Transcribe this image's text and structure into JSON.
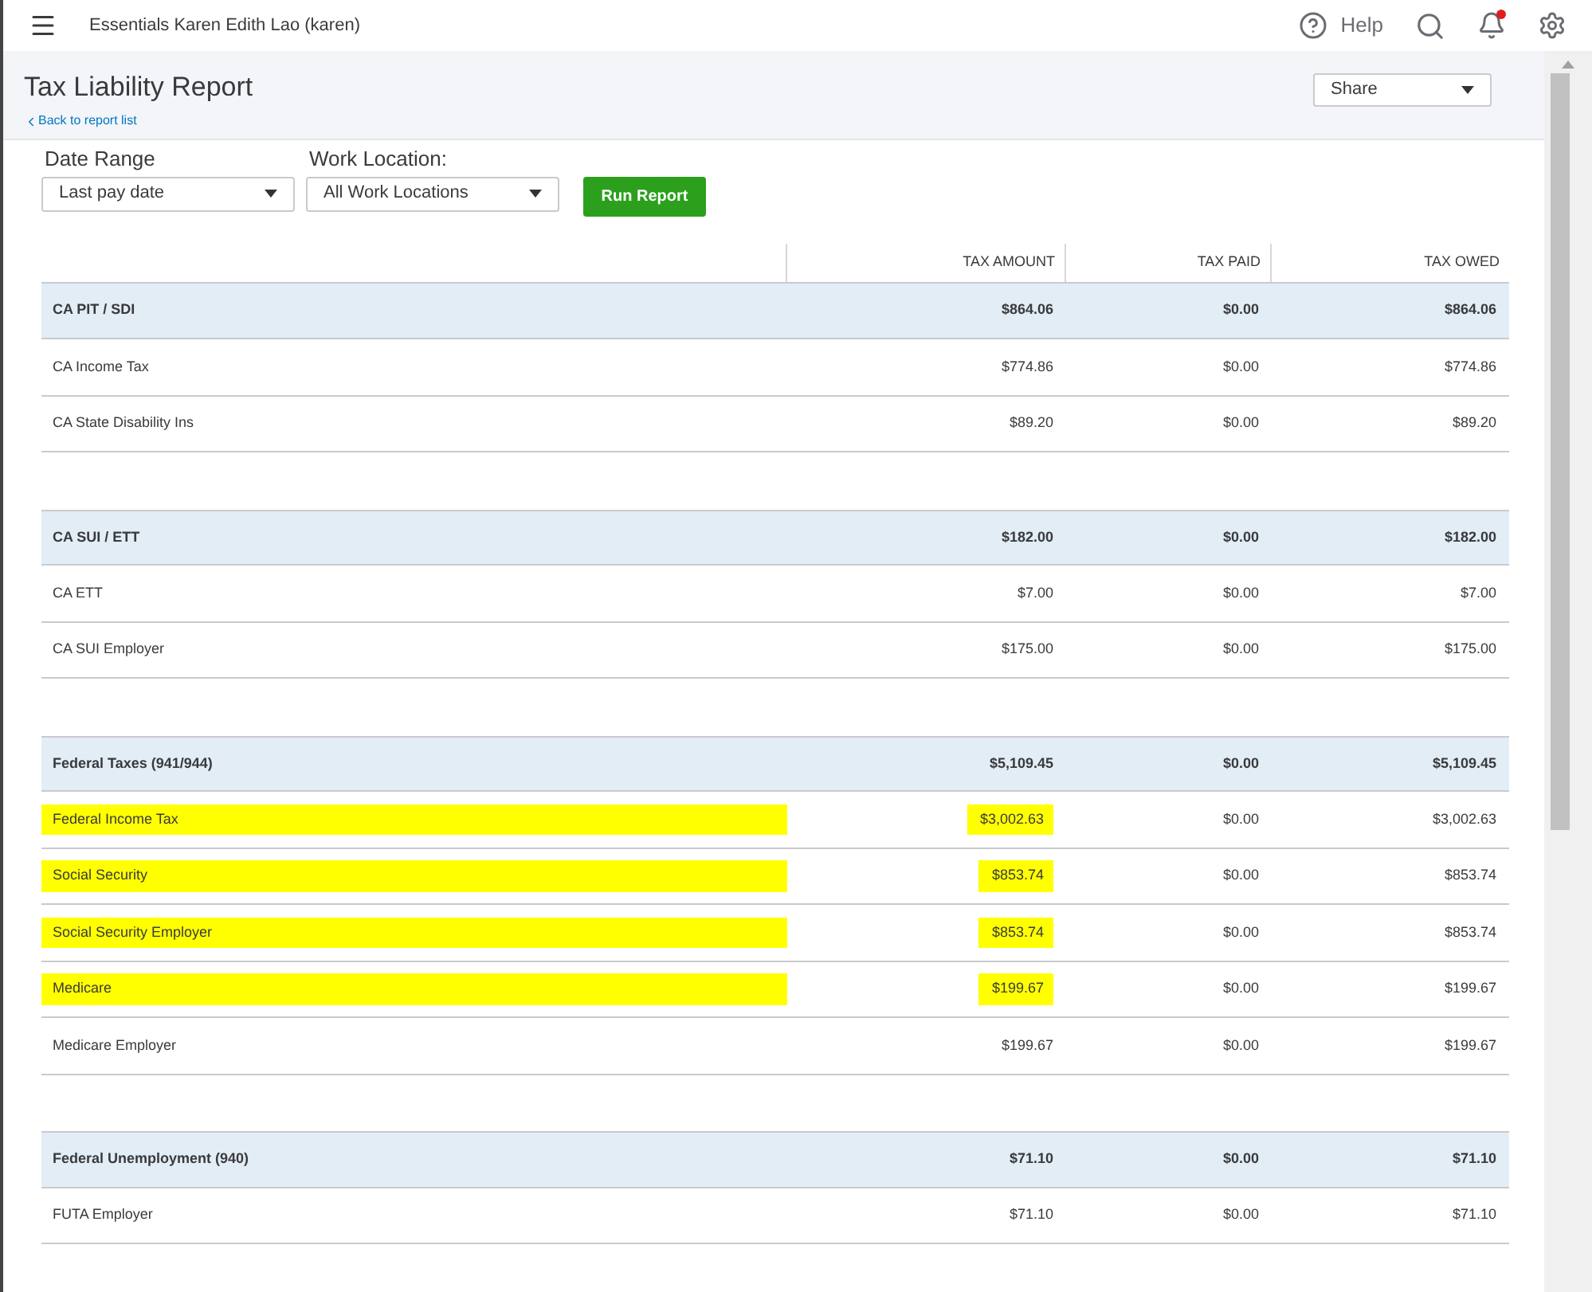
{
  "topbar": {
    "company": "Essentials Karen Edith Lao (karen)",
    "help": "Help",
    "notification_dot": true
  },
  "report": {
    "title": "Tax Liability Report",
    "back_link": "Back to report list",
    "share": "Share"
  },
  "filters": [
    {
      "label": "Date Range",
      "value": "Last pay date"
    },
    {
      "label": "Work Location:",
      "value": "All Work Locations"
    }
  ],
  "run_button": "Run Report",
  "table": {
    "columns": [
      "TAX AMOUNT",
      "TAX PAID",
      "TAX OWED"
    ],
    "groups": [
      {
        "name": "CA PIT / SDI",
        "values": [
          "$864.06",
          "$0.00",
          "$864.06"
        ],
        "rows": [
          {
            "name": "CA Income Tax",
            "values": [
              "$774.86",
              "$0.00",
              "$774.86"
            ],
            "highlighted": false
          },
          {
            "name": "CA State Disability Ins",
            "values": [
              "$89.20",
              "$0.00",
              "$89.20"
            ],
            "highlighted": false
          }
        ]
      },
      {
        "name": "CA SUI / ETT",
        "values": [
          "$182.00",
          "$0.00",
          "$182.00"
        ],
        "rows": [
          {
            "name": "CA ETT",
            "values": [
              "$7.00",
              "$0.00",
              "$7.00"
            ],
            "highlighted": false
          },
          {
            "name": "CA SUI Employer",
            "values": [
              "$175.00",
              "$0.00",
              "$175.00"
            ],
            "highlighted": false
          }
        ]
      },
      {
        "name": "Federal Taxes (941/944)",
        "values": [
          "$5,109.45",
          "$0.00",
          "$5,109.45"
        ],
        "rows": [
          {
            "name": "Federal Income Tax",
            "values": [
              "$3,002.63",
              "$0.00",
              "$3,002.63"
            ],
            "highlighted": true
          },
          {
            "name": "Social Security",
            "values": [
              "$853.74",
              "$0.00",
              "$853.74"
            ],
            "highlighted": true
          },
          {
            "name": "Social Security Employer",
            "values": [
              "$853.74",
              "$0.00",
              "$853.74"
            ],
            "highlighted": true
          },
          {
            "name": "Medicare",
            "values": [
              "$199.67",
              "$0.00",
              "$199.67"
            ],
            "highlighted": true
          },
          {
            "name": "Medicare Employer",
            "values": [
              "$199.67",
              "$0.00",
              "$199.67"
            ],
            "highlighted": false
          }
        ]
      },
      {
        "name": "Federal Unemployment (940)",
        "values": [
          "$71.10",
          "$0.00",
          "$71.10"
        ],
        "rows": [
          {
            "name": "FUTA Employer",
            "values": [
              "$71.10",
              "$0.00",
              "$71.10"
            ],
            "highlighted": false
          }
        ]
      }
    ]
  }
}
